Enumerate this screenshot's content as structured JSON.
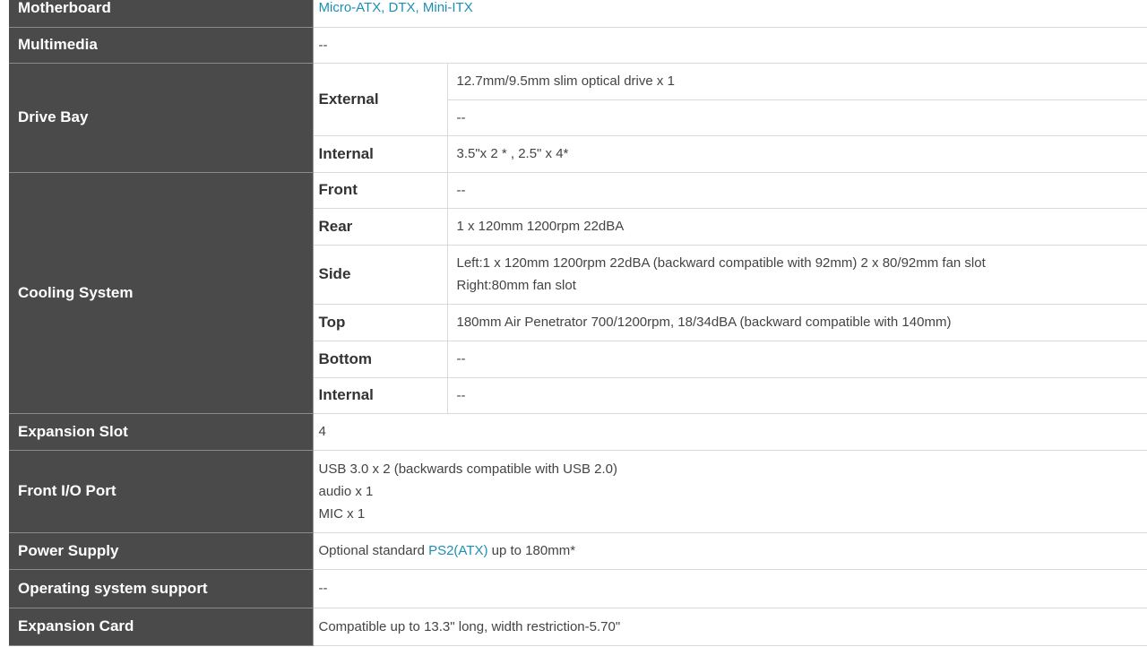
{
  "rows": {
    "motherboard": {
      "label": "Motherboard",
      "value": "Micro-ATX, DTX, Mini-ITX"
    },
    "multimedia": {
      "label": "Multimedia",
      "value": "--"
    },
    "drive_bay": {
      "label": "Drive Bay",
      "external_label": "External",
      "external_values": [
        "12.7mm/9.5mm slim optical drive x 1",
        "--"
      ],
      "internal_label": "Internal",
      "internal_value": "3.5\"x 2 * , 2.5\" x 4*"
    },
    "cooling": {
      "label": "Cooling System",
      "front_label": "Front",
      "front_value": "--",
      "rear_label": "Rear",
      "rear_value": "1 x 120mm 1200rpm 22dBA",
      "side_label": "Side",
      "side_value_1": "Left:1 x 120mm 1200rpm 22dBA (backward compatible with 92mm) 2 x 80/92mm fan slot",
      "side_value_2": "Right:80mm fan slot",
      "top_label": "Top",
      "top_value": "180mm Air Penetrator 700/1200rpm, 18/34dBA (backward compatible with 140mm)",
      "bottom_label": "Bottom",
      "bottom_value": "--",
      "internal_label": "Internal",
      "internal_value": "--"
    },
    "expansion_slot": {
      "label": "Expansion Slot",
      "value": "4"
    },
    "front_io": {
      "label": "Front I/O Port",
      "lines": [
        "USB 3.0 x 2 (backwards compatible with USB 2.0)",
        "audio x 1",
        "MIC x 1"
      ]
    },
    "power_supply": {
      "label": "Power Supply",
      "prefix": "Optional standard ",
      "link": "PS2(ATX)",
      "suffix": " up to 180mm*"
    },
    "os_support": {
      "label": "Operating system support",
      "value": "--"
    },
    "expansion_card": {
      "label": "Expansion Card",
      "value": "Compatible up to 13.3\" long, width restriction-5.70\""
    }
  },
  "colors": {
    "header_bg": "#4a4a4a",
    "link": "#1c8fb5",
    "divider": "#d9d9d9"
  }
}
